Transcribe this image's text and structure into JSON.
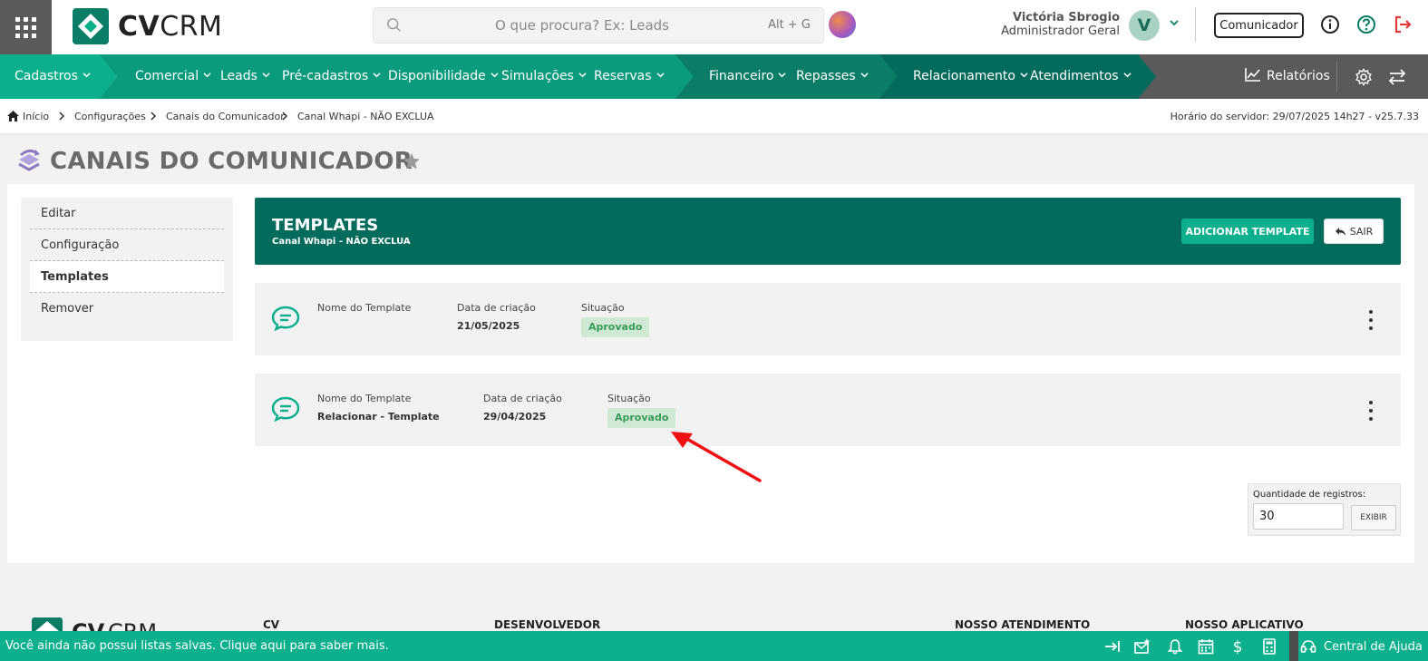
{
  "header": {
    "logo_text_bold": "CV",
    "logo_text_light": "CRM",
    "search_placeholder": "O que procura? Ex: Leads",
    "search_shortcut": "Alt + G",
    "user_name": "Victória Sbrogio",
    "user_role": "Administrador Geral",
    "avatar_letter": "V",
    "comunicador_label": "Comunicador"
  },
  "nav": {
    "items": [
      {
        "label": "Cadastros"
      },
      {
        "label": "Comercial"
      },
      {
        "label": "Leads"
      },
      {
        "label": "Pré-cadastros"
      },
      {
        "label": "Disponibilidade"
      },
      {
        "label": "Simulações"
      },
      {
        "label": "Reservas"
      },
      {
        "label": "Financeiro"
      },
      {
        "label": "Repasses"
      },
      {
        "label": "Relacionamento"
      },
      {
        "label": "Atendimentos"
      }
    ],
    "reports_label": "Relatórios",
    "colors": {
      "green_light": "#0db08c",
      "green_dark": "#026b5c",
      "gray": "#5a5a5a"
    }
  },
  "breadcrumb": {
    "items": [
      "Início",
      "Configurações",
      "Canais do Comunicador",
      "Canal Whapi - NÃO EXCLUA"
    ],
    "server_time": "Horário do servidor: 29/07/2025 14h27 - v25.7.33"
  },
  "page": {
    "title": "CANAIS DO COMUNICADOR"
  },
  "side_menu": {
    "items": [
      {
        "label": "Editar",
        "active": false
      },
      {
        "label": "Configuração",
        "active": false
      },
      {
        "label": "Templates",
        "active": true
      },
      {
        "label": "Remover",
        "active": false
      }
    ]
  },
  "templates": {
    "title": "TEMPLATES",
    "subtitle": "Canal Whapi - NÃO EXCLUA",
    "add_label": "ADICIONAR TEMPLATE",
    "exit_label": "SAIR",
    "col_name": "Nome do Template",
    "col_date": "Data de criação",
    "col_status": "Situação",
    "rows": [
      {
        "name": "",
        "date": "21/05/2025",
        "status": "Aprovado"
      },
      {
        "name": "Relacionar - Template",
        "date": "29/04/2025",
        "status": "Aprovado"
      }
    ]
  },
  "pagination": {
    "label": "Quantidade de registros:",
    "value": "30",
    "button": "EXIBIR"
  },
  "footer": {
    "columns": [
      "CV",
      "DESENVOLVEDOR",
      "NOSSO ATENDIMENTO",
      "NOSSO APLICATIVO"
    ]
  },
  "bottom_bar": {
    "message": "Você ainda não possui listas salvas. Clique aqui para saber mais.",
    "help_label": "Central de Ajuda"
  }
}
